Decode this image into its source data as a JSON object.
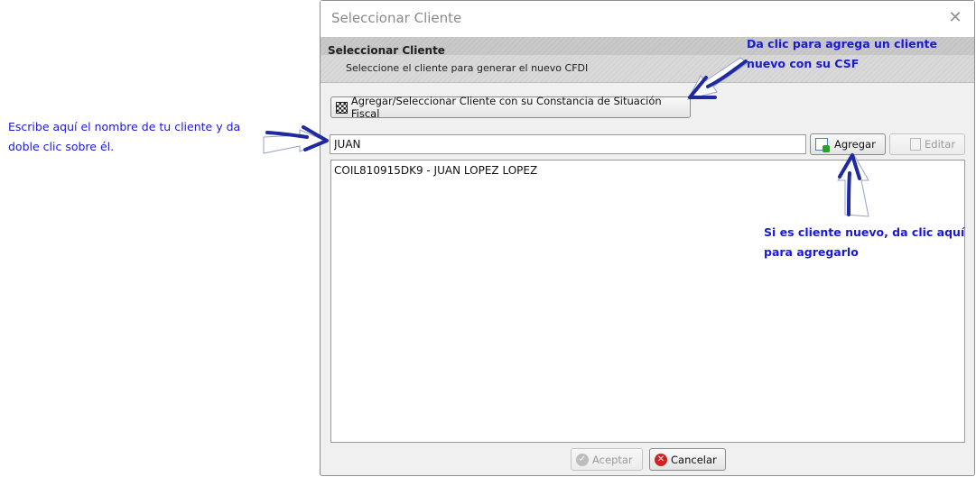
{
  "dialog": {
    "title": "Seleccionar Cliente",
    "close_glyph": "✕",
    "header_title": "Seleccionar Cliente",
    "header_subtitle": "Seleccione el cliente para generar el nuevo CFDI",
    "csf_button_label": "Agregar/Seleccionar Cliente con su Constancia de Situación Fiscal",
    "search_value": "JUAN",
    "agregar_label": "Agregar",
    "editar_label": "Editar",
    "list_items": [
      "COIL810915DK9 - JUAN LOPEZ LOPEZ"
    ],
    "aceptar_label": "Aceptar",
    "cancelar_label": "Cancelar"
  },
  "annotations": {
    "left_line1": "Escribe aquí el nombre de tu cliente y da",
    "left_line2": "doble clic sobre él.",
    "top_line1": "Da clic para agrega un cliente",
    "top_line2": "nuevo con su CSF",
    "right_line1": "Si es cliente nuevo, da clic aquí",
    "right_line2": "para agregarlo"
  },
  "icons": {
    "close": "close-icon",
    "csf": "qr-code-icon",
    "agregar": "add-document-icon",
    "editar": "edit-document-icon",
    "aceptar": "check-circle-icon",
    "cancelar": "cancel-circle-icon",
    "arrows": "hand-drawn-arrow-icon"
  },
  "colors": {
    "annotation_text": "#1a1ad6",
    "arrow": "#1f2a9e",
    "cancel": "#d32020"
  }
}
